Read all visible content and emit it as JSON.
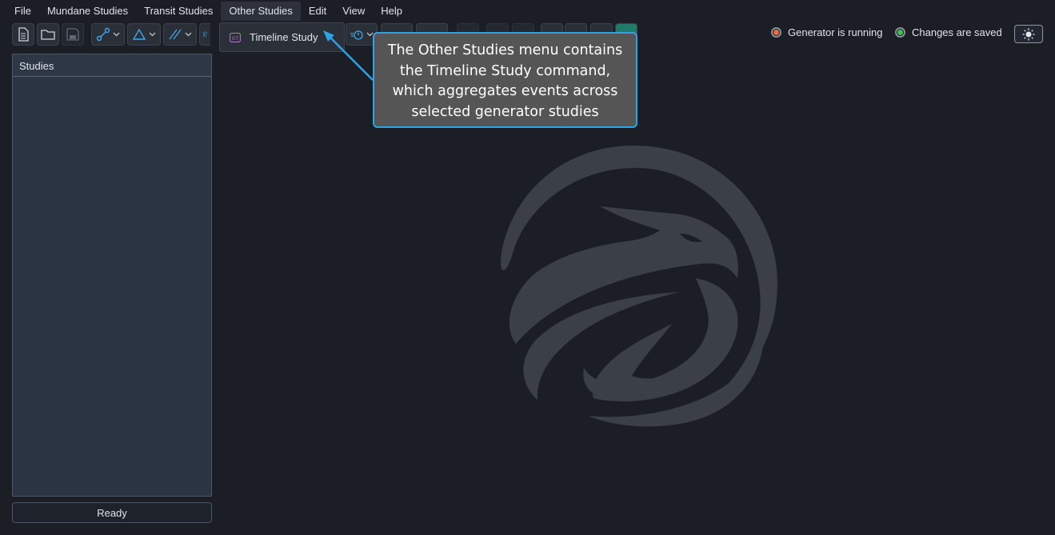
{
  "menubar": {
    "items": [
      {
        "label": "File"
      },
      {
        "label": "Mundane Studies"
      },
      {
        "label": "Transit Studies"
      },
      {
        "label": "Other Studies"
      },
      {
        "label": "Edit"
      },
      {
        "label": "View"
      },
      {
        "label": "Help"
      }
    ],
    "active_index": 3
  },
  "dropdown": {
    "items": [
      {
        "label": "Timeline Study",
        "icon": "calendar-icon",
        "icon_text": "07"
      }
    ]
  },
  "status": {
    "generator": {
      "label": "Generator is running",
      "color": "#f26b3a"
    },
    "saved": {
      "label": "Changes are saved",
      "color": "#3ec14a"
    }
  },
  "theme_toggle": {
    "icon": "sun-icon"
  },
  "studies_panel": {
    "header": "Studies"
  },
  "status_bar": {
    "text": "Ready"
  },
  "callout": {
    "text": "The Other Studies menu contains the Timeline Study command, which aggregates events across selected generator studies"
  },
  "colors": {
    "background": "#1b1e25",
    "accent": "#2ea3e3",
    "panel": "#2b3442",
    "watermark": "#3a3f48"
  }
}
